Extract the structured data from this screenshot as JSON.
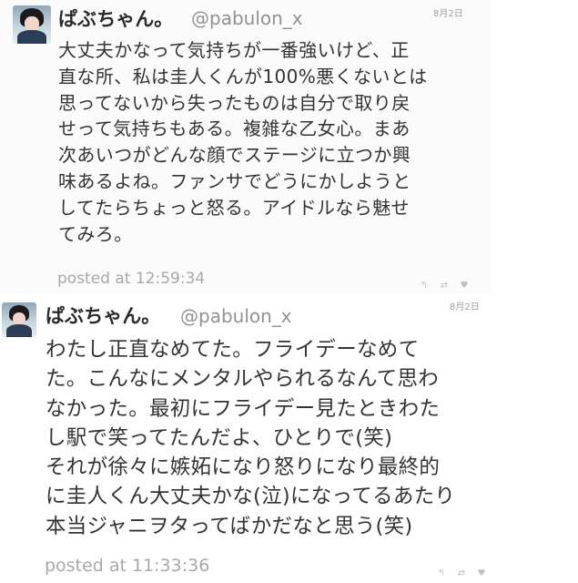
{
  "tweets": [
    {
      "name": "ぱぶちゃん。",
      "handle": "@pabulon_x",
      "date": "8月2日",
      "text": "大丈夫かなって気持ちが一番強いけど、正\n直な所、私は圭人くんが100%悪くないとは\n思ってないから失ったものは自分で取り戻\nせって気持ちもある。複雑な乙女心。まあ\n次あいつがどんな顔でステージに立つか興\n味あるよね。ファンサでどうにかしようと\nしてたらちょっと怒る。アイドルなら魅せ\nてみろ。",
      "posted": "posted at 12:59:34",
      "actions": [
        {
          "icon": "reply-icon",
          "glyph": "↰"
        },
        {
          "icon": "retweet-icon",
          "glyph": "⇄"
        },
        {
          "icon": "heart-icon",
          "glyph": "♥"
        }
      ]
    },
    {
      "name": "ぱぶちゃん。",
      "handle": "@pabulon_x",
      "date": "8月2日",
      "text": "わたし正直なめてた。フライデーなめて\nた。こんなにメンタルやられるなんて思わ\nなかった。最初にフライデー見たときわた\nし駅で笑ってたんだよ、ひとりで(笑)\nそれが徐々に嫉妬になり怒りになり最終的\nに圭人くん大丈夫かな(泣)になってるあたり\n本当ジャニヲタってばかだなと思う(笑)",
      "posted": "posted at 11:33:36",
      "actions": [
        {
          "icon": "reply-icon",
          "glyph": "↰"
        },
        {
          "icon": "retweet-icon",
          "glyph": "⇄"
        },
        {
          "icon": "heart-icon",
          "glyph": "♥"
        }
      ]
    }
  ]
}
